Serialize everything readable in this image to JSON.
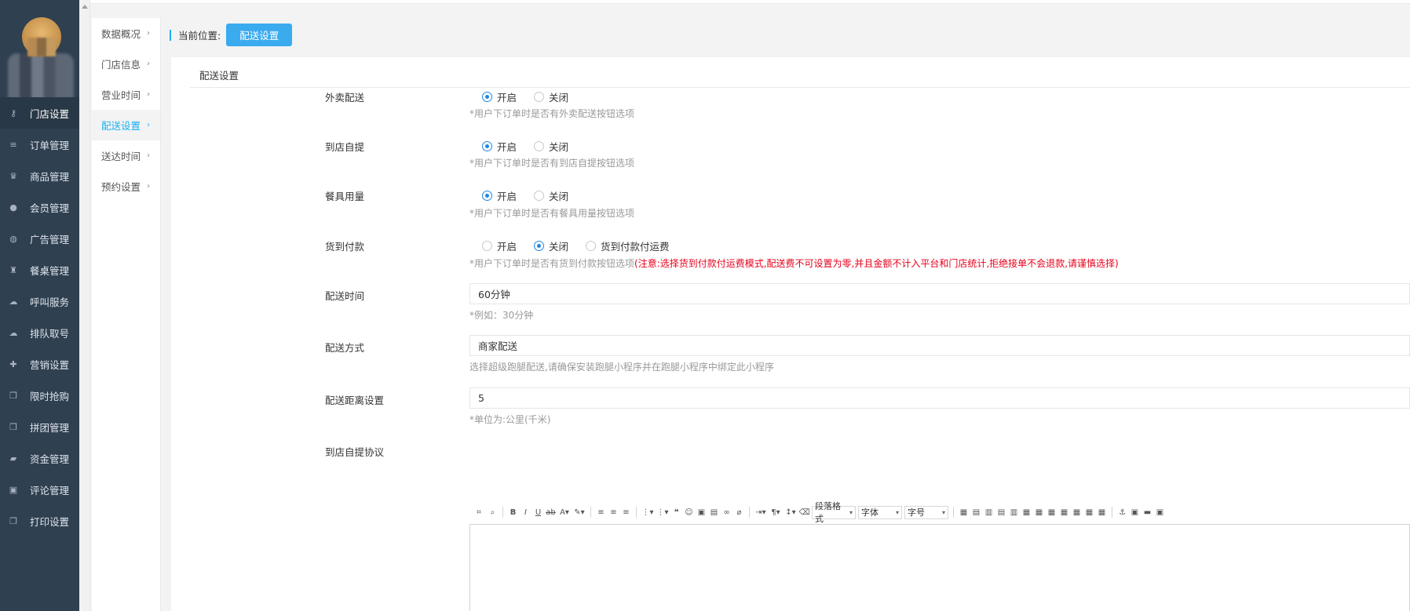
{
  "sidebar": {
    "items": [
      {
        "label": "门店设置",
        "icon": "key-icon",
        "glyph": "⚷",
        "active": true
      },
      {
        "label": "订单管理",
        "icon": "list-icon",
        "glyph": "≡"
      },
      {
        "label": "商品管理",
        "icon": "trophy-icon",
        "glyph": "♛"
      },
      {
        "label": "会员管理",
        "icon": "user-icon",
        "glyph": "●"
      },
      {
        "label": "广告管理",
        "icon": "globe-icon",
        "glyph": "◍"
      },
      {
        "label": "餐桌管理",
        "icon": "binoculars-icon",
        "glyph": "♜"
      },
      {
        "label": "呼叫服务",
        "icon": "cloud-icon",
        "glyph": "☁"
      },
      {
        "label": "排队取号",
        "icon": "cloud-icon",
        "glyph": "☁"
      },
      {
        "label": "营销设置",
        "icon": "gift-icon",
        "glyph": "✚"
      },
      {
        "label": "限时抢购",
        "icon": "copy-icon",
        "glyph": "❐"
      },
      {
        "label": "拼团管理",
        "icon": "copy-icon",
        "glyph": "❐"
      },
      {
        "label": "资金管理",
        "icon": "book-icon",
        "glyph": "▰"
      },
      {
        "label": "评论管理",
        "icon": "money-icon",
        "glyph": "▣"
      },
      {
        "label": "打印设置",
        "icon": "copy-icon",
        "glyph": "❐"
      }
    ]
  },
  "submenu": {
    "items": [
      {
        "label": "数据概况"
      },
      {
        "label": "门店信息"
      },
      {
        "label": "营业时间"
      },
      {
        "label": "配送设置",
        "active": true
      },
      {
        "label": "送达时间"
      },
      {
        "label": "预约设置"
      }
    ]
  },
  "breadcrumb": {
    "label": "当前位置:",
    "current": "配送设置"
  },
  "panel": {
    "title": "配送设置"
  },
  "settings": {
    "waimai": {
      "label": "外卖配送",
      "opt_on": "开启",
      "opt_off": "关闭",
      "hint": "*用户下订单时是否有外卖配送按钮选项"
    },
    "ziti": {
      "label": "到店自提",
      "opt_on": "开启",
      "opt_off": "关闭",
      "hint": "*用户下订单时是否有到店自提按钮选项"
    },
    "canju": {
      "label": "餐具用量",
      "opt_on": "开启",
      "opt_off": "关闭",
      "hint": "*用户下订单时是否有餐具用量按钮选项"
    },
    "huodao": {
      "label": "货到付款",
      "opt_on": "开启",
      "opt_off": "关闭",
      "opt_fee": "货到付款付运费",
      "hint": "*用户下订单时是否有货到付款按钮选项",
      "warn": "(注意:选择货到付款付运费模式,配送费不可设置为零,并且金额不计入平台和门店统计,拒绝接单不会退款,请谨慎选择)"
    },
    "time": {
      "label": "配送时间",
      "value": "60分钟",
      "hint": "*例如：30分钟"
    },
    "method": {
      "label": "配送方式",
      "value": "商家配送",
      "hint": "选择超级跑腿配送,请确保安装跑腿小程序并在跑腿小程序中绑定此小程序"
    },
    "distance": {
      "label": "配送距离设置",
      "value": "5",
      "hint": "*单位为:公里(千米)"
    },
    "agreement": {
      "label": "到店自提协议"
    }
  },
  "editor": {
    "sel_paragraph": "段落格式",
    "sel_font": "字体",
    "sel_size": "字号"
  }
}
